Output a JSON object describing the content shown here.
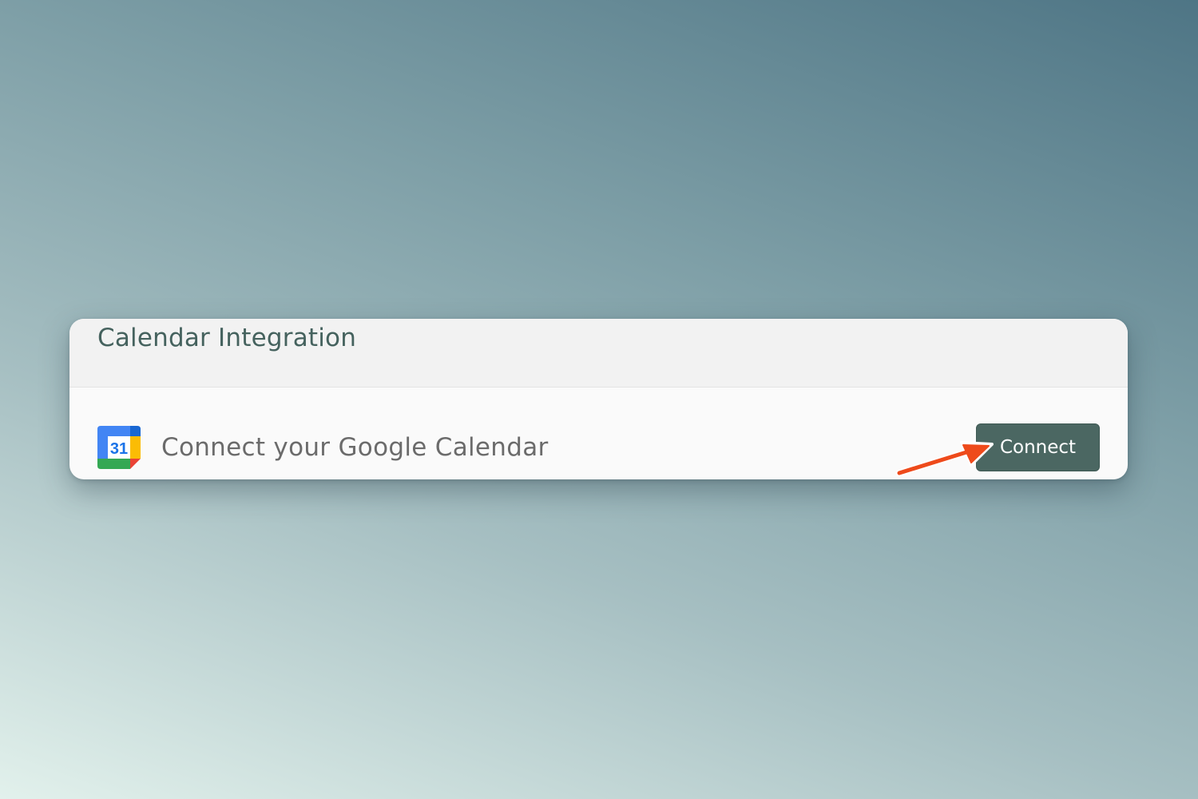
{
  "card": {
    "title": "Calendar Integration",
    "integration": {
      "icon": "google-calendar-icon",
      "icon_day": "31",
      "label": "Connect your Google Calendar",
      "button_label": "Connect"
    }
  },
  "annotation": {
    "icon": "arrow-pointer-icon",
    "color": "#ee4a1b"
  },
  "colors": {
    "button_bg": "#4b6762",
    "title_text": "#45625e",
    "body_text": "#6b6b6b"
  }
}
